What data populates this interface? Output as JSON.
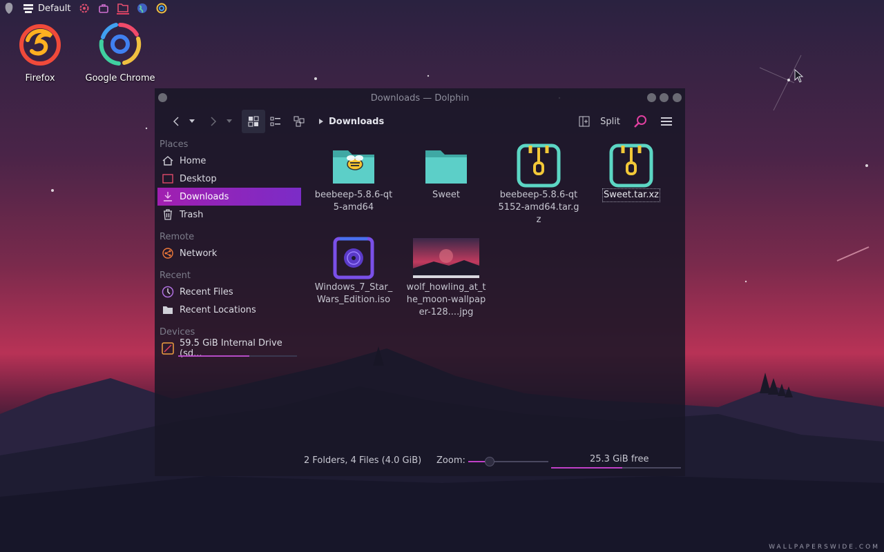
{
  "topbar": {
    "activity_label": "Default"
  },
  "desktop": {
    "icons": [
      {
        "label": "Firefox"
      },
      {
        "label": "Google Chrome"
      }
    ]
  },
  "window": {
    "title": "Downloads — Dolphin"
  },
  "toolbar": {
    "breadcrumb": "Downloads",
    "split_label": "Split"
  },
  "sidebar": {
    "sections": {
      "places": "Places",
      "remote": "Remote",
      "recent": "Recent",
      "devices": "Devices"
    },
    "places": [
      {
        "label": "Home",
        "icon": "home-icon"
      },
      {
        "label": "Desktop",
        "icon": "desktop-icon"
      },
      {
        "label": "Downloads",
        "icon": "downloads-icon"
      },
      {
        "label": "Trash",
        "icon": "trash-icon"
      }
    ],
    "remote": [
      {
        "label": "Network",
        "icon": "network-icon"
      }
    ],
    "recent": [
      {
        "label": "Recent Files",
        "icon": "recent-files-icon"
      },
      {
        "label": "Recent Locations",
        "icon": "recent-locations-icon"
      }
    ],
    "devices": [
      {
        "label": "59.5 GiB Internal Drive (sd...",
        "icon": "drive-icon",
        "usage_fraction": 0.6
      }
    ],
    "active": "Downloads"
  },
  "files": [
    {
      "name": "beebeep-5.8.6-qt5-amd64",
      "kind": "folder-beebeep"
    },
    {
      "name": "Sweet",
      "kind": "folder"
    },
    {
      "name": "beebeep-5.8.6-qt5152-amd64.tar.gz",
      "kind": "archive"
    },
    {
      "name": "Sweet.tar.xz",
      "kind": "archive",
      "selected": true
    },
    {
      "name": "Windows_7_Star_Wars_Edition.iso",
      "kind": "disc-image"
    },
    {
      "name": "wolf_howling_at_the_moon-wallpaper-128....jpg",
      "kind": "image"
    }
  ],
  "status": {
    "summary": "2 Folders, 4 Files (4.0 GiB)",
    "zoom_label": "Zoom:",
    "zoom_fraction": 0.27,
    "free_space": "25.3 GiB free",
    "used_fraction": 0.55
  },
  "watermark": "WALLPAPERSWIDE.COM",
  "colors": {
    "accent": "#b03ac0",
    "folder": "#58c6c0",
    "archive_frame": "#5cd6c4",
    "archive_mark": "#f2c838"
  }
}
